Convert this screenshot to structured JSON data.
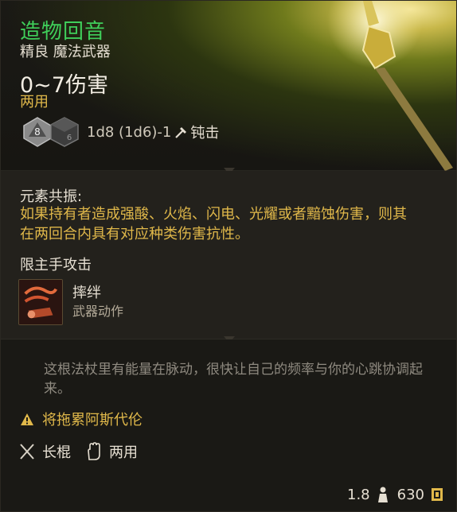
{
  "item": {
    "name": "造物回音",
    "rarity_category": "精良 魔法武器",
    "damage": "0~7伤害",
    "handedness": "两用",
    "dice": {
      "die1": "8",
      "die2": "6"
    },
    "damage_formula": "1d8 (1d6)-1",
    "damage_type": "钝击"
  },
  "passive": {
    "title": "元素共振:",
    "description": "如果持有者造成强酸、火焰、闪电、光耀或者黯蚀伤害，则其在两回合内具有对应种类伤害抗性。"
  },
  "main_hand_label": "限主手攻击",
  "action": {
    "name": "摔绊",
    "type": "武器动作"
  },
  "flavor_text": "这根法杖里有能量在脉动，很快让自己的频率与你的心跳协调起来。",
  "warning": "将拖累阿斯代伦",
  "proficiency": {
    "weapon": "长棍",
    "hands": "两用"
  },
  "footer": {
    "weight": "1.8",
    "price": "630"
  },
  "colors": {
    "rarity_green": "#3fce5a",
    "accent_gold": "#e0b84a",
    "flavor_gray": "#8f8a80"
  },
  "icons": [
    "staff-image",
    "d8-die-icon",
    "d6-die-icon",
    "bludgeoning-icon",
    "trip-action-icon",
    "warning-icon",
    "quarterstaff-icon",
    "hand-icon",
    "weight-icon",
    "gold-coin-icon"
  ]
}
